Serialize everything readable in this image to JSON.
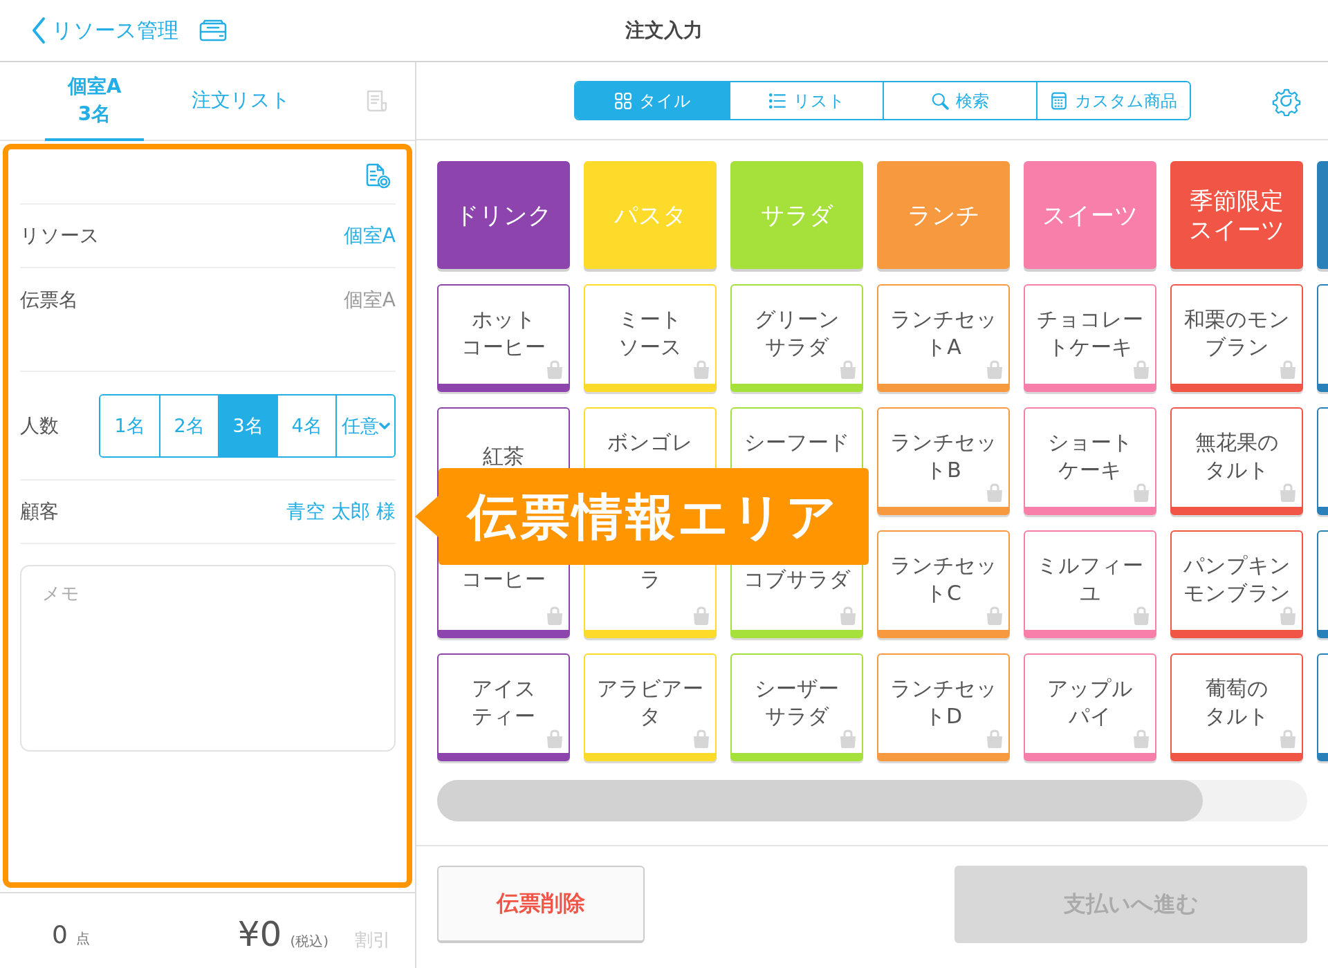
{
  "header": {
    "back_label": "リソース管理",
    "title": "注文入力"
  },
  "left_tabs": [
    {
      "label": "個室A",
      "sublabel": "3名",
      "selected": true
    },
    {
      "label": "注文リスト",
      "selected": false
    }
  ],
  "slip": {
    "rows": [
      {
        "kind": "link",
        "label": "リソース",
        "value": "個室A"
      },
      {
        "kind": "text",
        "label": "伝票名",
        "value": "個室A"
      },
      {
        "kind": "segments",
        "label": "人数",
        "options": [
          {
            "label": "1名",
            "kind": "count",
            "selected": false
          },
          {
            "label": "2名",
            "kind": "count",
            "selected": false
          },
          {
            "label": "3名",
            "kind": "count",
            "selected": true
          },
          {
            "label": "4名",
            "kind": "count",
            "selected": false
          },
          {
            "label": "任意",
            "kind": "dropdown",
            "selected": false
          }
        ]
      },
      {
        "kind": "link",
        "label": "顧客",
        "value": "青空 太郎 様"
      }
    ],
    "memo": {
      "placeholder": "メモ"
    }
  },
  "footer": {
    "count": "0",
    "count_unit": "点",
    "total": "¥0",
    "tax_note": "(税込)",
    "discount": {
      "label": "割引",
      "disabled": true
    }
  },
  "view_tabs": [
    {
      "kind": "tile",
      "label": "タイル",
      "selected": true
    },
    {
      "kind": "list",
      "label": "リスト",
      "selected": false
    },
    {
      "kind": "search",
      "label": "検索",
      "selected": false
    },
    {
      "kind": "custom",
      "label": "カスタム商品",
      "selected": false
    }
  ],
  "categories": [
    {
      "lines": [
        "ドリンク"
      ],
      "color": "#8e44ad"
    },
    {
      "lines": [
        "パスタ"
      ],
      "color": "#fddb2a"
    },
    {
      "lines": [
        "サラダ"
      ],
      "color": "#a6e03a"
    },
    {
      "lines": [
        "ランチ"
      ],
      "color": "#f7993f"
    },
    {
      "lines": [
        "スイーツ"
      ],
      "color": "#f87fa9"
    },
    {
      "lines": [
        "季節限定",
        "スイーツ"
      ],
      "color": "#f05545"
    },
    {
      "color": "#2a80b9"
    }
  ],
  "item_rows": [
    [
      {
        "lines": [
          "ホット",
          "コーヒー"
        ]
      },
      {
        "lines": [
          "ミート",
          "ソース"
        ]
      },
      {
        "lines": [
          "グリーン",
          "サラダ"
        ]
      },
      {
        "lines": [
          "ランチセッ",
          "トA"
        ]
      },
      {
        "lines": [
          "チョコレー",
          "トケーキ"
        ]
      },
      {
        "lines": [
          "和栗のモン",
          "ブラン"
        ]
      },
      {}
    ],
    [
      {
        "lines": [
          "紅茶"
        ],
        "bag_covered": true
      },
      {
        "lines": [
          "ボンゴレ"
        ],
        "covered_below": true,
        "bag_covered": true
      },
      {
        "lines": [
          "シーフード"
        ],
        "covered_below": true,
        "bag_covered": true
      },
      {
        "lines": [
          "ランチセッ",
          "トB"
        ]
      },
      {
        "lines": [
          "ショート",
          "ケーキ"
        ]
      },
      {
        "lines": [
          "無花果の",
          "タルト"
        ]
      },
      {}
    ],
    [
      {
        "lines": [
          "コーヒー"
        ]
      },
      {
        "lines": [
          "ラ"
        ]
      },
      {
        "lines": [
          "コブサラダ"
        ]
      },
      {
        "lines": [
          "ランチセッ",
          "トC"
        ]
      },
      {
        "lines": [
          "ミルフィー",
          "ユ"
        ]
      },
      {
        "lines": [
          "パンプキン",
          "モンブラン"
        ]
      },
      {}
    ],
    [
      {
        "lines": [
          "アイス",
          "ティー"
        ]
      },
      {
        "lines": [
          "アラビアー",
          "タ"
        ]
      },
      {
        "lines": [
          "シーザー",
          "サラダ"
        ]
      },
      {
        "lines": [
          "ランチセッ",
          "トD"
        ]
      },
      {
        "lines": [
          "アップル",
          "パイ"
        ]
      },
      {
        "lines": [
          "葡萄の",
          "タルト"
        ]
      },
      {}
    ]
  ],
  "callout": {
    "text": "伝票情報エリア"
  },
  "actions": [
    {
      "kind": "danger",
      "label": "伝票削除",
      "disabled": false
    },
    {
      "kind": "primary",
      "label": "支払いへ進む",
      "disabled": true
    }
  ]
}
